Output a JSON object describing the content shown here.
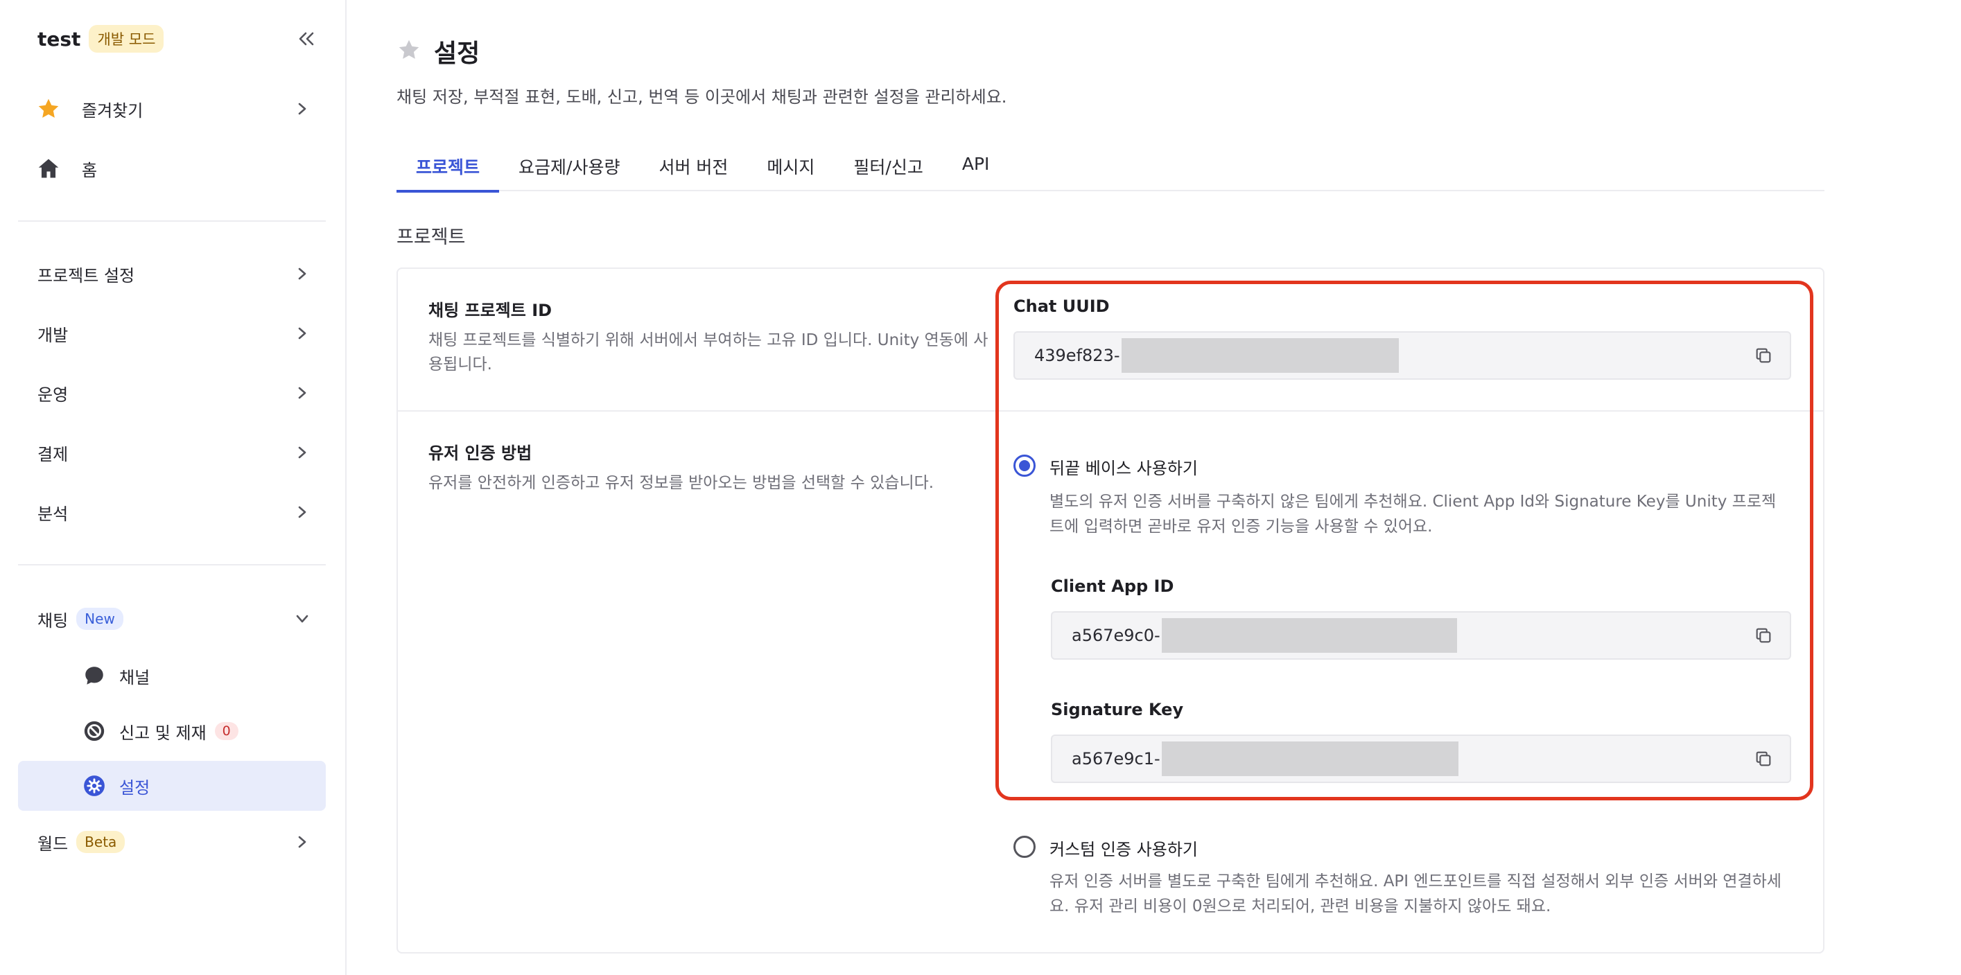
{
  "sidebar": {
    "brand": "test",
    "mode_badge": "개발 모드",
    "items": [
      {
        "label": "즐겨찾기"
      },
      {
        "label": "홈"
      },
      {
        "label": "프로젝트 설정"
      },
      {
        "label": "개발"
      },
      {
        "label": "운영"
      },
      {
        "label": "결제"
      },
      {
        "label": "분석"
      },
      {
        "label": "채팅",
        "badge": "New"
      },
      {
        "label": "채널"
      },
      {
        "label": "신고 및 제재",
        "badge": "0"
      },
      {
        "label": "설정"
      },
      {
        "label": "월드",
        "badge": "Beta"
      }
    ]
  },
  "page": {
    "title": "설정",
    "description": "채팅 저장, 부적절 표현, 도배, 신고, 번역 등 이곳에서 채팅과 관련한 설정을 관리하세요."
  },
  "tabs": [
    "프로젝트",
    "요금제/사용량",
    "서버 버전",
    "메시지",
    "필터/신고",
    "API"
  ],
  "section_title": "프로젝트",
  "project_id_row": {
    "title": "채팅 프로젝트 ID",
    "description": "채팅 프로젝트를 식별하기 위해 서버에서 부여하는 고유 ID 입니다. Unity 연동에 사용됩니다.",
    "field_label": "Chat UUID",
    "value": "439ef823-"
  },
  "auth_row": {
    "title": "유저 인증 방법",
    "description": "유저를 안전하게 인증하고 유저 정보를 받아오는 방법을 선택할 수 있습니다.",
    "option1": {
      "label": "뒤끝 베이스 사용하기",
      "description": "별도의 유저 인증 서버를 구축하지 않은 팀에게 추천해요. Client App Id와 Signature Key를 Unity 프로젝트에 입력하면 곧바로 유저 인증 기능을 사용할 수 있어요.",
      "client_app_id_label": "Client App ID",
      "client_app_id_value": "a567e9c0-",
      "signature_key_label": "Signature Key",
      "signature_key_value": "a567e9c1-"
    },
    "option2": {
      "label": "커스텀 인증 사용하기",
      "description": "유저 인증 서버를 별도로 구축한 팀에게 추천해요. API 엔드포인트를 직접 설정해서 외부 인증 서버와 연결하세요. 유저 관리 비용이 0원으로 처리되어, 관련 비용을 지불하지 않아도 돼요."
    }
  },
  "colors": {
    "accent": "#3a55d6",
    "highlight": "#e2351e",
    "star_active": "#f5a623"
  }
}
